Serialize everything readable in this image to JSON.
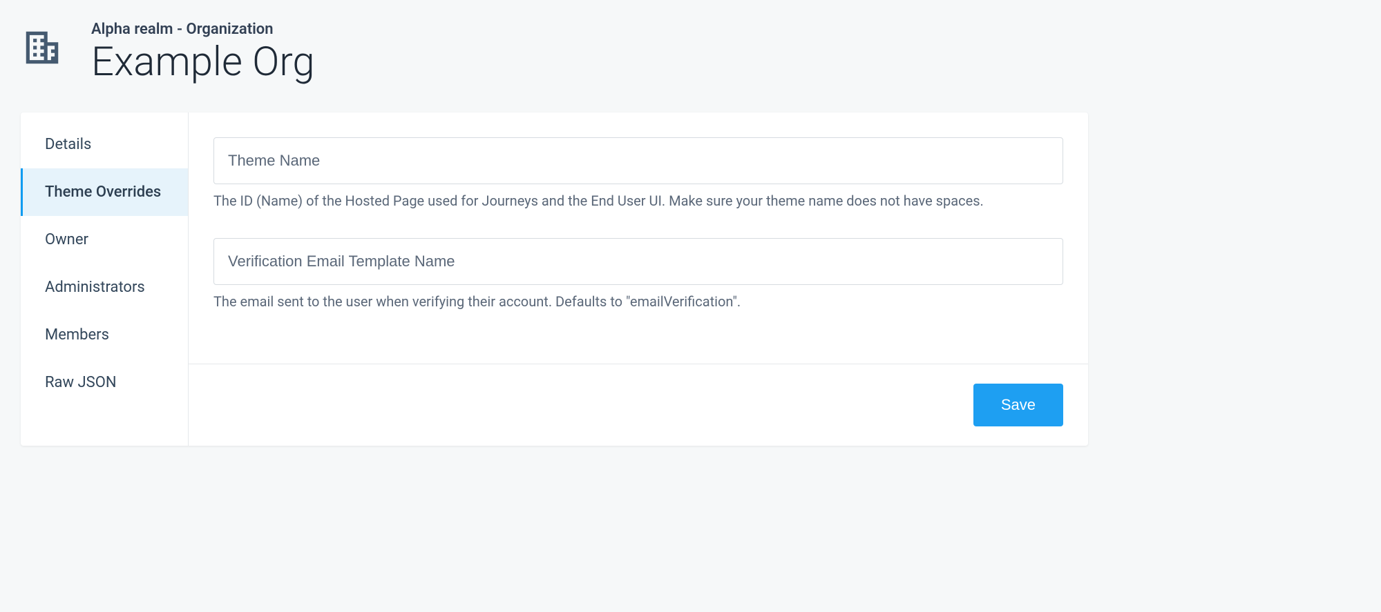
{
  "header": {
    "breadcrumb": "Alpha realm - Organization",
    "title": "Example Org"
  },
  "sidebar": {
    "items": [
      {
        "label": "Details",
        "active": false
      },
      {
        "label": "Theme Overrides",
        "active": true
      },
      {
        "label": "Owner",
        "active": false
      },
      {
        "label": "Administrators",
        "active": false
      },
      {
        "label": "Members",
        "active": false
      },
      {
        "label": "Raw JSON",
        "active": false
      }
    ]
  },
  "form": {
    "theme_name": {
      "placeholder": "Theme Name",
      "value": "",
      "help": "The ID (Name) of the Hosted Page used for Journeys and the End User UI. Make sure your theme name does not have spaces."
    },
    "verification_email": {
      "placeholder": "Verification Email Template Name",
      "value": "",
      "help": "The email sent to the user when verifying their account. Defaults to \"emailVerification\"."
    }
  },
  "footer": {
    "save_label": "Save"
  }
}
